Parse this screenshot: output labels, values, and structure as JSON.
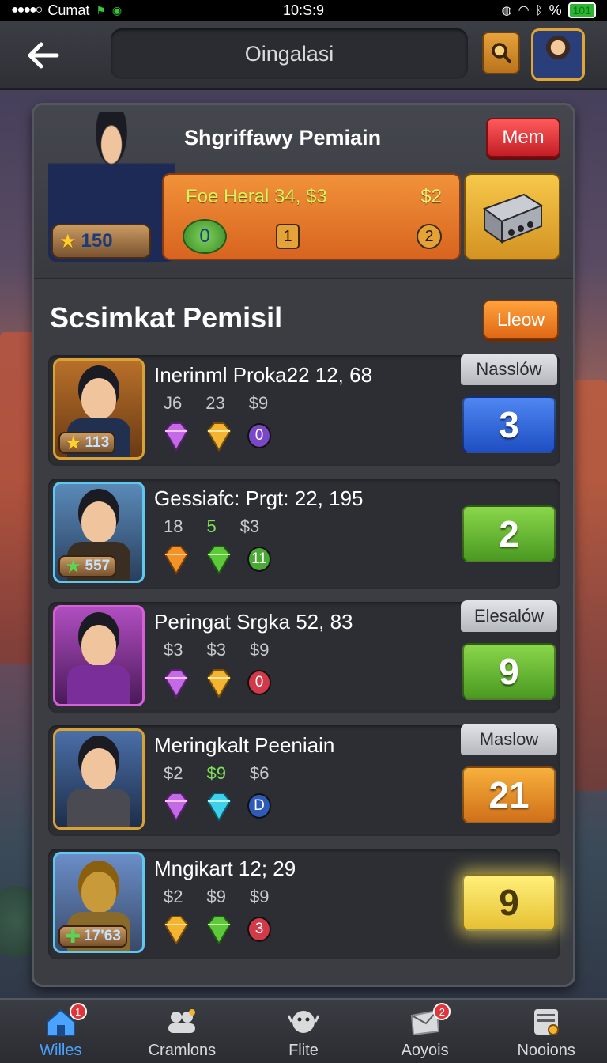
{
  "status_bar": {
    "carrier": "Cumat",
    "time": "10:S:9",
    "percent": "%",
    "battery": "101"
  },
  "header": {
    "title": "Oingalasi"
  },
  "profile": {
    "name": "Shgriffawy Pemiain",
    "level": "150",
    "mem_button": "Mem",
    "stats_title": "Foe Heral 34, $3",
    "stats_money": "$2",
    "stats_values": [
      "0",
      "1",
      "2"
    ]
  },
  "section": {
    "title": "Scsimkat Pemisil",
    "button": "Lleow"
  },
  "rows": [
    {
      "title": "Inerinml Proka22 12, 68",
      "stats": [
        "J6",
        "23",
        "$9"
      ],
      "coin": "0",
      "badge": "113",
      "tag": "Nasslów",
      "rank": "3"
    },
    {
      "title": "Gessiafc: Prgt: 22, 195",
      "stats": [
        "18",
        "5",
        "$3"
      ],
      "coin": "11",
      "badge": "557",
      "tag": "",
      "rank": "2"
    },
    {
      "title": "Peringat Srgka 52, 83",
      "stats": [
        "$3",
        "$3",
        "$9"
      ],
      "coin": "0",
      "badge": "",
      "tag": "Elesalów",
      "rank": "9"
    },
    {
      "title": "Meringkalt Peeniain",
      "stats": [
        "$2",
        "$9",
        "$6"
      ],
      "coin": "D",
      "badge": "",
      "tag": "Maslow",
      "rank": "21"
    },
    {
      "title": "Mngikart 12; 29",
      "stats": [
        "$2",
        "$9",
        "$9"
      ],
      "coin": "3",
      "badge": "17'63",
      "tag": "",
      "rank": "9"
    }
  ],
  "nav": [
    {
      "label": "Willes",
      "badge": "1"
    },
    {
      "label": "Cramlons",
      "badge": ""
    },
    {
      "label": "Flite",
      "badge": ""
    },
    {
      "label": "Aoyois",
      "badge": "2"
    },
    {
      "label": "Nooions",
      "badge": ""
    }
  ],
  "colors": {
    "accent_blue": "#4aa3ff",
    "mem_red": "#c31e25",
    "orange": "#e06816"
  }
}
